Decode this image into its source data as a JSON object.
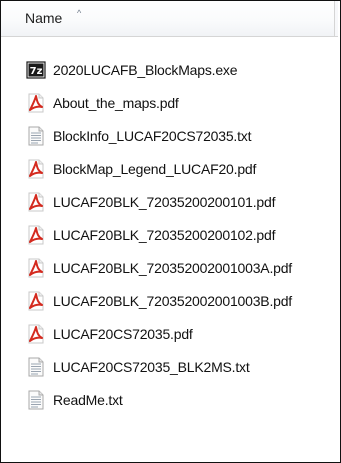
{
  "header": {
    "name_label": "Name",
    "sort_arrow": "^"
  },
  "files": [
    {
      "name": "2020LUCAFB_BlockMaps.exe",
      "icon": "7z-archive-icon"
    },
    {
      "name": "About_the_maps.pdf",
      "icon": "pdf-icon"
    },
    {
      "name": "BlockInfo_LUCAF20CS72035.txt",
      "icon": "text-file-icon"
    },
    {
      "name": "BlockMap_Legend_LUCAF20.pdf",
      "icon": "pdf-icon"
    },
    {
      "name": "LUCAF20BLK_72035200200101.pdf",
      "icon": "pdf-icon"
    },
    {
      "name": "LUCAF20BLK_72035200200102.pdf",
      "icon": "pdf-icon"
    },
    {
      "name": "LUCAF20BLK_720352002001003A.pdf",
      "icon": "pdf-icon"
    },
    {
      "name": "LUCAF20BLK_720352002001003B.pdf",
      "icon": "pdf-icon"
    },
    {
      "name": "LUCAF20CS72035.pdf",
      "icon": "pdf-icon"
    },
    {
      "name": "LUCAF20CS72035_BLK2MS.txt",
      "icon": "text-file-icon"
    },
    {
      "name": "ReadMe.txt",
      "icon": "text-file-icon"
    }
  ],
  "colors": {
    "pdf_red": "#d42a1f",
    "archive_dark": "#1a1a1a",
    "text_file_line": "#9aa4b0"
  }
}
